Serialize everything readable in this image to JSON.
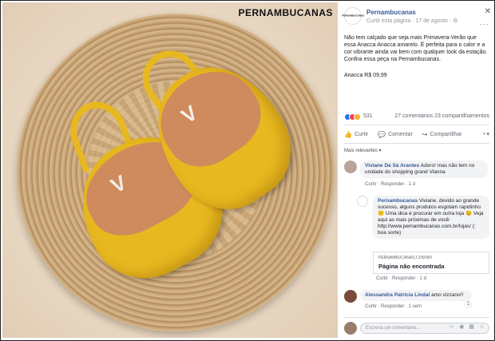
{
  "photo": {
    "watermark": "PERNAMBUCANAS",
    "sandal_mark": "V",
    "colors": {
      "sandal": "#e8b820",
      "sole": "#cf8b5d",
      "basket": "#c9a679"
    }
  },
  "post": {
    "page_name": "Pernambucanas",
    "page_avatar_text": "PERNAMBUCANAS",
    "subtitle": "Curtir esta página · 17 de agosto · ⚙",
    "close_label": "✕",
    "more_label": "···",
    "body": "Não tem calçado que seja mais Primavera-Verão que essa Anacca Anacca amarelo. É perfeita para o calor e a cor vibrante ainda vai bem com qualquer look da estação. Confira essa peça na Pernambucanas.",
    "price": "Anacca R$ 09,99",
    "reaction_count": "531",
    "stats": "27 comentários  23 compartilhamentos",
    "actions": [
      {
        "icon": "👍",
        "label": "Curtir"
      },
      {
        "icon": "💬",
        "label": "Comentar"
      },
      {
        "icon": "↪",
        "label": "Compartilhar"
      }
    ],
    "actions_end": "⚬▾",
    "relevant_label": "Mais relevantes ▾"
  },
  "comments": [
    {
      "author": "Viviane De Sá Arantes",
      "text": " Adoro! mas não tem no unidade do shopping grand Vianna",
      "meta": "Curtir · Responder · 1 d"
    },
    {
      "author": "Pernambucanas",
      "text": " Viviane, devido ao grande sucesso, alguns produtos esgotam rapidinho 😕 Uma dica é procurar em outra loja 😉 Veja aqui as mais próximas de você: http://www.pernambucanas.com.br/lojas/ (: boa sorte)",
      "card_domain": "PERNAMBUCANAS.COM.BR",
      "card_title": "Página não encontrada",
      "meta": "Curtir · Responder · 1 d"
    },
    {
      "author": "Alessandra Patricia Lindal",
      "text": " amo vizzano!!",
      "meta": "Curtir · Responder · 1 sem",
      "reactions": "1"
    }
  ],
  "composer": {
    "placeholder": "Escreva um comentário...",
    "icons": "☺ ◉ ▦ ☺"
  }
}
